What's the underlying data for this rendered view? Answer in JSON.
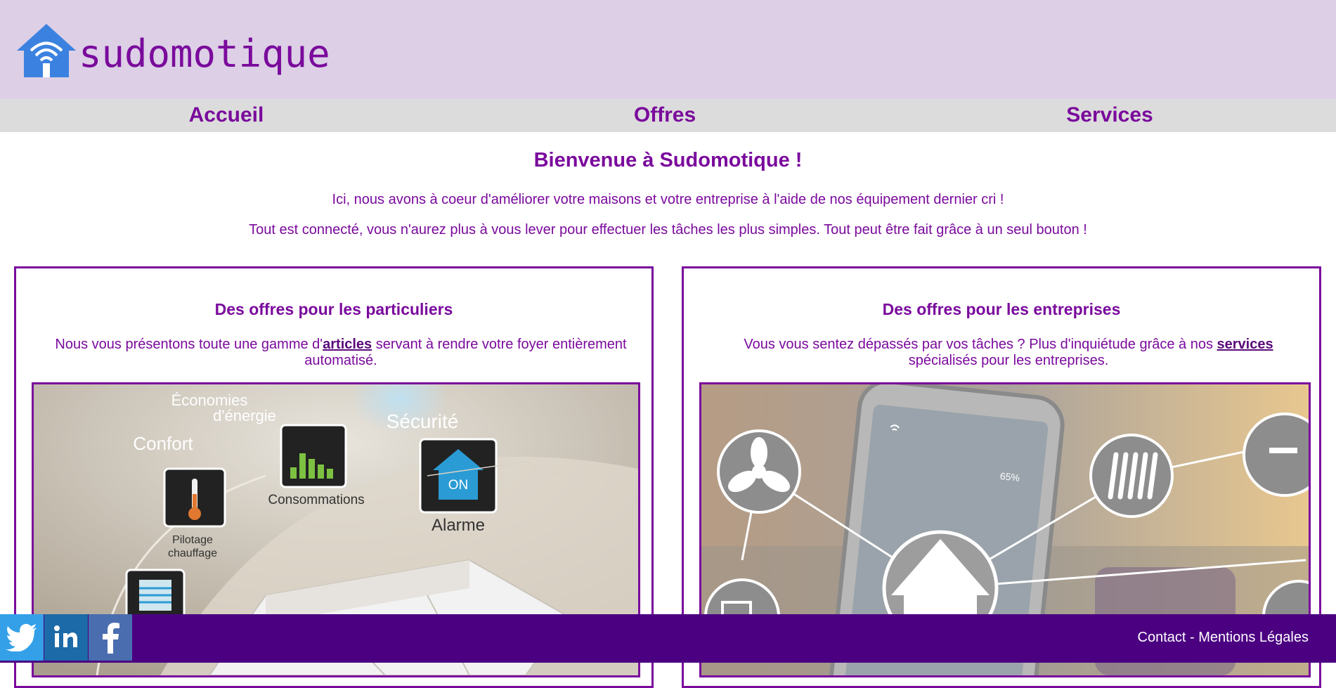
{
  "brand": {
    "name": "sudomotique"
  },
  "nav": {
    "items": [
      "Accueil",
      "Offres",
      "Services"
    ]
  },
  "main": {
    "title": "Bienvenue à Sudomotique !",
    "intro": [
      "Ici, nous avons à coeur d'améliorer votre maisons et votre entreprise à l'aide de nos équipement dernier cri !",
      "Tout est connecté, vous n'aurez plus à vous lever pour effectuer les tâches les plus simples. Tout peut être fait grâce à un seul bouton !"
    ]
  },
  "cards": [
    {
      "title": "Des offres pour les particuliers",
      "text_before": "Nous vous présentons toute une gamme d'",
      "link": "articles",
      "text_after": " servant à rendre votre foyer entièrement automatisé.",
      "image_labels": [
        "Économies",
        "d'énergie",
        "Sécurité",
        "Confort",
        "Consommations",
        "Alarme",
        "ON",
        "Pilotage",
        "chauffage"
      ]
    },
    {
      "title": "Des offres pour les entreprises",
      "text_before": "Vous vous sentez dépassés par vos tâches ? Plus d'inquiétude grâce à nos ",
      "link": "services",
      "text_after": " spécialisés pour les entreprises.",
      "image_labels": [
        "65%"
      ]
    }
  ],
  "footer": {
    "social": [
      "twitter-icon",
      "linkedin-icon",
      "facebook-icon"
    ],
    "links": [
      "Contact",
      "Mentions Légales"
    ],
    "separator": " - "
  },
  "colors": {
    "accent": "#7a0a9c",
    "header_bg": "#dccfe6",
    "nav_bg": "#dcdcdc",
    "footer_bg": "#4b0082"
  }
}
